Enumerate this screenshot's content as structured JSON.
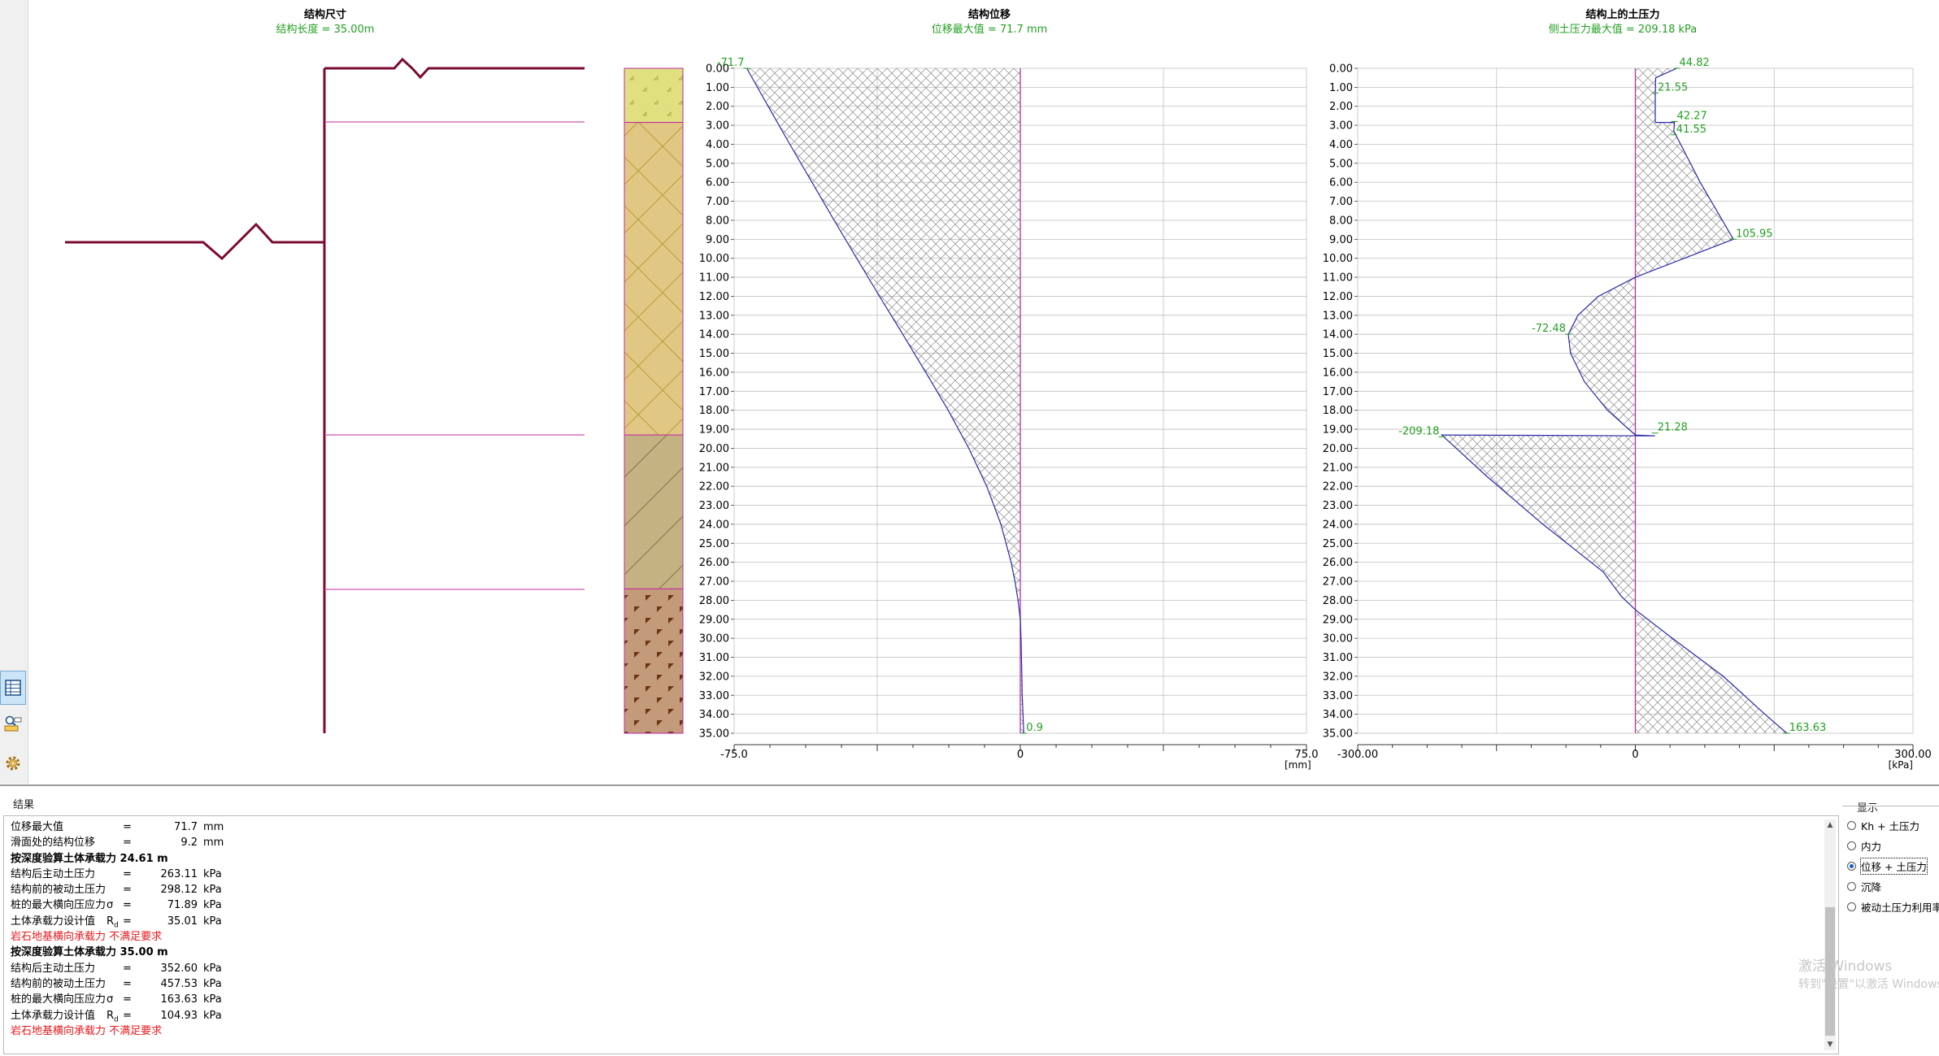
{
  "toolbar": {
    "icons": [
      "table-icon",
      "text-edit-icon",
      "gear-icon"
    ]
  },
  "structure_dims": {
    "title": "结构尺寸",
    "subtitle": "结构长度 = 35.00m"
  },
  "displacement_chart": {
    "title": "结构位移",
    "subtitle": "位移最大值 = 71.7 mm",
    "unit": "[mm]",
    "x_ticks": [
      "-75.0",
      "0",
      "75.0"
    ]
  },
  "pressure_chart": {
    "title": "结构上的土压力",
    "subtitle": "侧土压力最大值 = 209.18 kPa",
    "unit": "[kPa]",
    "x_ticks": [
      "-300.00",
      "0",
      "300.00"
    ]
  },
  "chart_data": [
    {
      "type": "line",
      "title": "结构位移",
      "subtitle": "位移最大值 = 71.7 mm",
      "xlabel": "[mm]",
      "xlim": [
        -75.0,
        75.0
      ],
      "ylim": [
        0,
        35
      ],
      "y_ticks": [
        "0.00",
        "1.00",
        "2.00",
        "3.00",
        "4.00",
        "5.00",
        "6.00",
        "7.00",
        "8.00",
        "9.00",
        "10.00",
        "11.00",
        "12.00",
        "13.00",
        "14.00",
        "15.00",
        "16.00",
        "17.00",
        "18.00",
        "19.00",
        "20.00",
        "21.00",
        "22.00",
        "23.00",
        "24.00",
        "25.00",
        "26.00",
        "27.00",
        "28.00",
        "29.00",
        "30.00",
        "31.00",
        "32.00",
        "33.00",
        "34.00",
        "35.00"
      ],
      "series": [
        {
          "points": [
            [
              0,
              -71.7
            ],
            [
              2,
              -66.1
            ],
            [
              4,
              -60.4
            ],
            [
              6,
              -54.6
            ],
            [
              8,
              -48.8
            ],
            [
              10,
              -42.9
            ],
            [
              12,
              -36.9
            ],
            [
              14,
              -30.8
            ],
            [
              16,
              -24.8
            ],
            [
              18,
              -18.9
            ],
            [
              20,
              -13.5
            ],
            [
              22,
              -8.8
            ],
            [
              24,
              -5.1
            ],
            [
              26,
              -2.4
            ],
            [
              27,
              -1.4
            ],
            [
              28,
              -0.6
            ],
            [
              29,
              0
            ],
            [
              30,
              0.2
            ],
            [
              31,
              0.3
            ],
            [
              32,
              0.4
            ],
            [
              33,
              0.5
            ],
            [
              34,
              0.7
            ],
            [
              35,
              0.9
            ]
          ]
        }
      ],
      "annotations": [
        {
          "depth": 0,
          "value": -71.7,
          "label": "-71.7"
        },
        {
          "depth": 35,
          "value": 0.9,
          "label": "0.9"
        }
      ]
    },
    {
      "type": "line",
      "title": "结构上的土压力",
      "subtitle": "侧土压力最大值 = 209.18 kPa",
      "xlabel": "[kPa]",
      "xlim": [
        -300.0,
        300.0
      ],
      "ylim": [
        0,
        35
      ],
      "y_ticks": [
        "0.00",
        "1.00",
        "2.00",
        "3.00",
        "4.00",
        "5.00",
        "6.00",
        "7.00",
        "8.00",
        "9.00",
        "10.00",
        "11.00",
        "12.00",
        "13.00",
        "14.00",
        "15.00",
        "16.00",
        "17.00",
        "18.00",
        "19.00",
        "20.00",
        "21.00",
        "22.00",
        "23.00",
        "24.00",
        "25.00",
        "26.00",
        "27.00",
        "28.00",
        "29.00",
        "30.00",
        "31.00",
        "32.00",
        "33.00",
        "34.00",
        "35.00"
      ],
      "series": [
        {
          "points": [
            [
              0,
              44.82
            ],
            [
              0.5,
              22
            ],
            [
              1.5,
              21.55
            ],
            [
              2.85,
              21.55
            ],
            [
              2.85,
              42.27
            ],
            [
              3.3,
              41.55
            ],
            [
              6,
              70
            ],
            [
              9,
              105.95
            ],
            [
              11,
              0
            ],
            [
              12,
              -40
            ],
            [
              13,
              -62
            ],
            [
              14,
              -72.48
            ],
            [
              15,
              -70
            ],
            [
              16.5,
              -55
            ],
            [
              18,
              -30
            ],
            [
              19.3,
              0
            ],
            [
              19.35,
              21.28
            ],
            [
              19.3,
              -209.18
            ],
            [
              21.5,
              -160
            ],
            [
              24,
              -100
            ],
            [
              26.5,
              -35
            ],
            [
              27.8,
              -15
            ],
            [
              28.5,
              0
            ],
            [
              30,
              40
            ],
            [
              32,
              95
            ],
            [
              34,
              140
            ],
            [
              35,
              163.63
            ]
          ]
        }
      ],
      "annotations": [
        {
          "depth": 0,
          "value": 44.82,
          "label": "44.82"
        },
        {
          "depth": 1.3,
          "value": 21.55,
          "label": "21.55"
        },
        {
          "depth": 2.8,
          "value": 42.27,
          "label": "42.27"
        },
        {
          "depth": 3.5,
          "value": 41.55,
          "label": "41.55"
        },
        {
          "depth": 9.0,
          "value": 105.95,
          "label": "105.95"
        },
        {
          "depth": 14.0,
          "value": -72.48,
          "label": "-72.48"
        },
        {
          "depth": 19.2,
          "value": 21.28,
          "label": "21.28"
        },
        {
          "depth": 19.4,
          "value": -209.18,
          "label": "-209.18"
        },
        {
          "depth": 35,
          "value": 163.63,
          "label": "163.63"
        }
      ]
    }
  ],
  "soil_layers": [
    {
      "from": 0.0,
      "to": 2.85,
      "color": "#e0e080"
    },
    {
      "from": 2.85,
      "to": 19.3,
      "color": "#e1c784"
    },
    {
      "from": 19.3,
      "to": 27.4,
      "color": "#c5b283"
    },
    {
      "from": 27.4,
      "to": 35.0,
      "color": "#c39b7a"
    }
  ],
  "results": {
    "panel_label": "结果",
    "lines": [
      {
        "label": "位移最大值",
        "sym": "",
        "value": "71.7",
        "unit": "mm",
        "kind": "row"
      },
      {
        "label": "滑面处的结构位移",
        "sym": "",
        "value": "9.2",
        "unit": "mm",
        "kind": "row"
      },
      {
        "text": "按深度验算土体承载力 24.61 m",
        "kind": "heading"
      },
      {
        "label": "结构后主动土压力",
        "sym": "",
        "value": "263.11",
        "unit": "kPa",
        "kind": "row"
      },
      {
        "label": "结构前的被动土压力",
        "sym": "",
        "value": "298.12",
        "unit": "kPa",
        "kind": "row"
      },
      {
        "label": "桩的最大横向压应力",
        "sym": "σ",
        "value": "71.89",
        "unit": "kPa",
        "kind": "row"
      },
      {
        "label": "土体承载力设计值",
        "sym": "Rd",
        "value": "35.01",
        "unit": "kPa",
        "kind": "row"
      },
      {
        "text": "岩石地基横向承载力 不满足要求",
        "kind": "warn"
      },
      {
        "text": "按深度验算土体承载力 35.00 m",
        "kind": "heading"
      },
      {
        "label": "结构后主动土压力",
        "sym": "",
        "value": "352.60",
        "unit": "kPa",
        "kind": "row"
      },
      {
        "label": "结构前的被动土压力",
        "sym": "",
        "value": "457.53",
        "unit": "kPa",
        "kind": "row"
      },
      {
        "label": "桩的最大横向压应力",
        "sym": "σ",
        "value": "163.63",
        "unit": "kPa",
        "kind": "row"
      },
      {
        "label": "土体承载力设计值",
        "sym": "Rd",
        "value": "104.93",
        "unit": "kPa",
        "kind": "row"
      },
      {
        "text": "岩石地基横向承载力 不满足要求",
        "kind": "warn"
      }
    ]
  },
  "display": {
    "panel_label": "显示",
    "options": [
      {
        "label": "Kh + 土压力",
        "selected": false
      },
      {
        "label": "内力",
        "selected": false
      },
      {
        "label": "位移 + 土压力",
        "selected": true
      },
      {
        "label": "沉降",
        "selected": false
      },
      {
        "label": "被动土压力利用率",
        "selected": false
      }
    ]
  },
  "watermark": {
    "line1": "激活 Windows",
    "line2": "转到\"设置\"以激活 Windows"
  }
}
